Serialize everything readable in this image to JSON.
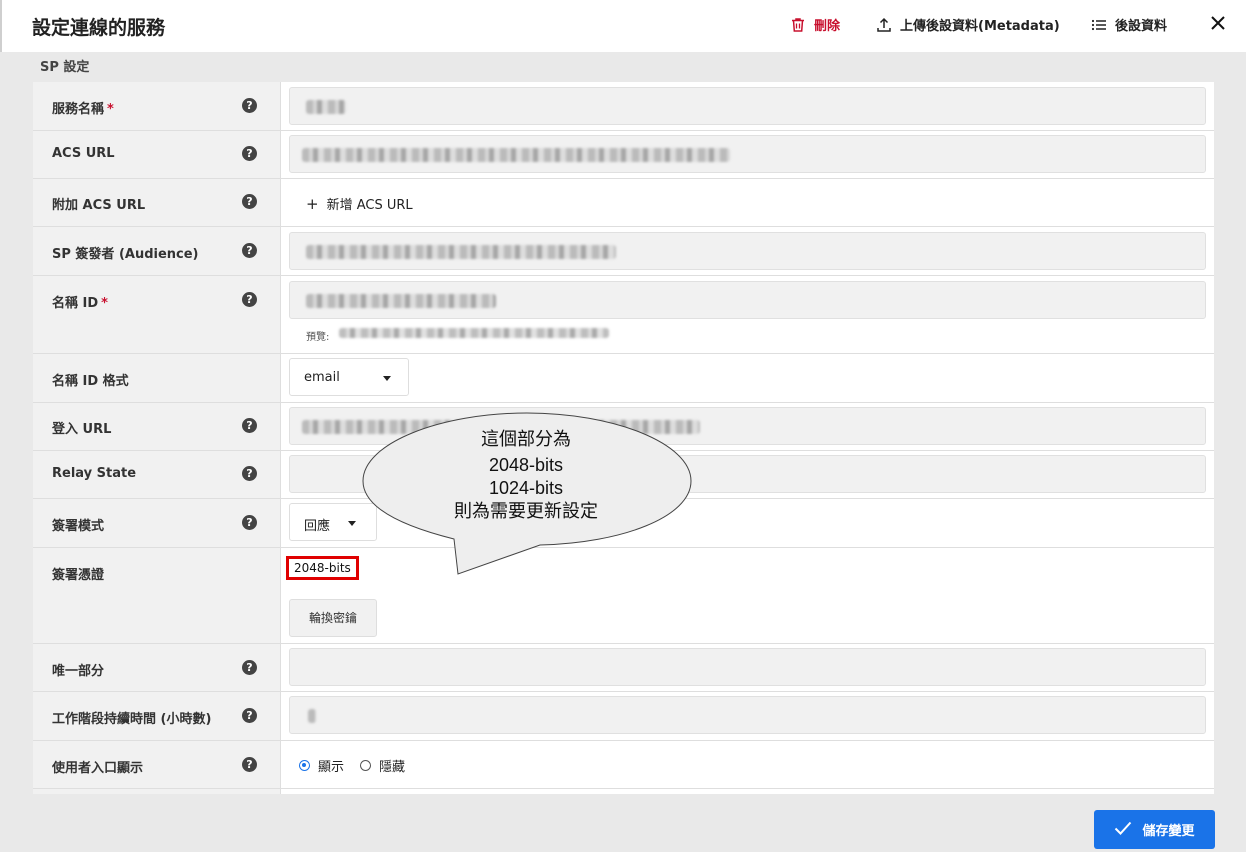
{
  "header": {
    "title": "設定連線的服務",
    "delete_label": "刪除",
    "upload_label": "上傳後設資料(Metadata)",
    "metadata_label": "後設資料"
  },
  "section": {
    "title": "SP 設定"
  },
  "fields": {
    "service_name": {
      "label": "服務名稱",
      "required": "*"
    },
    "acs_url": {
      "label": "ACS URL"
    },
    "extra_acs": {
      "label": "附加 ACS URL",
      "add_label": "新增 ACS URL"
    },
    "sp_issuer": {
      "label": "SP 簽發者 (Audience)"
    },
    "name_id": {
      "label": "名稱 ID",
      "required": "*",
      "preview_label": "預覽:"
    },
    "name_id_format": {
      "label": "名稱 ID 格式",
      "value": "email"
    },
    "login_url": {
      "label": "登入 URL"
    },
    "relay_state": {
      "label": "Relay State"
    },
    "signing_mode": {
      "label": "簽署模式",
      "value": "回應"
    },
    "signing_cert": {
      "label": "簽署憑證",
      "value": "2048-bits",
      "rotate_label": "輪換密鑰"
    },
    "unique_part": {
      "label": "唯一部分"
    },
    "session_duration": {
      "label": "工作階段持續時間 (小時數)"
    },
    "portal_display": {
      "label": "使用者入口顯示",
      "show_label": "顯示",
      "hide_label": "隱藏",
      "selected": "顯示"
    }
  },
  "callout": {
    "line1": "這個部分為",
    "line2": "2048-bits",
    "line3": "1024-bits",
    "line4": "則為需要更新設定"
  },
  "footer": {
    "save_label": "儲存變更"
  },
  "colors": {
    "accent": "#1a73e8",
    "danger": "#c8102e",
    "highlight": "#e00000"
  }
}
